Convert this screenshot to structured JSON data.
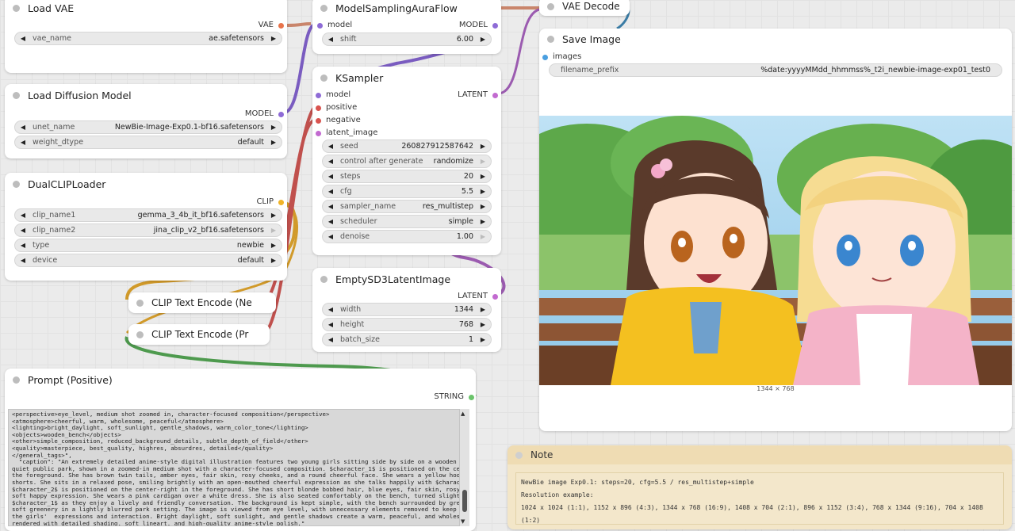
{
  "nodes": {
    "load_vae": {
      "title": "Load VAE",
      "output": "VAE",
      "widget_name": "vae_name",
      "widget_value": "ae.safetensors"
    },
    "model_sampling": {
      "title": "ModelSamplingAuraFlow",
      "input": "model",
      "output": "MODEL",
      "widget_name": "shift",
      "widget_value": "6.00"
    },
    "vae_decode": {
      "title": "VAE Decode"
    },
    "save_image": {
      "title": "Save Image",
      "input": "images",
      "widget_name": "filename_prefix",
      "widget_value": "%date:yyyyMMdd_hhmmss%_t2i_newbie-image-exp01_test0",
      "size_label": "1344 × 768"
    },
    "load_diffusion": {
      "title": "Load Diffusion Model",
      "output": "MODEL",
      "widgets": [
        {
          "name": "unet_name",
          "value": "NewBie-Image-Exp0.1-bf16.safetensors"
        },
        {
          "name": "weight_dtype",
          "value": "default"
        }
      ]
    },
    "ksampler": {
      "title": "KSampler",
      "output": "LATENT",
      "inputs": [
        "model",
        "positive",
        "negative",
        "latent_image"
      ],
      "widgets": [
        {
          "name": "seed",
          "value": "260827912587642"
        },
        {
          "name": "control after generate",
          "value": "randomize"
        },
        {
          "name": "steps",
          "value": "20"
        },
        {
          "name": "cfg",
          "value": "5.5"
        },
        {
          "name": "sampler_name",
          "value": "res_multistep"
        },
        {
          "name": "scheduler",
          "value": "simple"
        },
        {
          "name": "denoise",
          "value": "1.00"
        }
      ]
    },
    "dual_clip": {
      "title": "DualCLIPLoader",
      "output": "CLIP",
      "widgets": [
        {
          "name": "clip_name1",
          "value": "gemma_3_4b_it_bf16.safetensors"
        },
        {
          "name": "clip_name2",
          "value": "jina_clip_v2_bf16.safetensors"
        },
        {
          "name": "type",
          "value": "newbie"
        },
        {
          "name": "device",
          "value": "default"
        }
      ]
    },
    "empty_latent": {
      "title": "EmptySD3LatentImage",
      "output": "LATENT",
      "widgets": [
        {
          "name": "width",
          "value": "1344"
        },
        {
          "name": "height",
          "value": "768"
        },
        {
          "name": "batch_size",
          "value": "1"
        }
      ]
    },
    "clip_text_neg": {
      "title": "CLIP Text Encode (Ne"
    },
    "clip_text_pos": {
      "title": "CLIP Text Encode (Pr"
    },
    "prompt_positive": {
      "title": "Prompt (Positive)",
      "output": "STRING",
      "text": "<perspective>eye_level, medium shot zoomed in, character-focused composition</perspective>\n<atmosphere>cheerful, warm, wholesome, peaceful</atmosphere>\n<lighting>bright_daylight, soft_sunlight, gentle_shadows, warm_color_tone</lighting>\n<objects>wooden_bench</objects>\n<other>simple_composition, reduced_background_details, subtle_depth_of_field</other>\n<quality>masterpiece, best_quality, highres, absurdres, detailed</quality>\n</general_tags>\",\n  \"caption\": \"An extremely detailed anime-style digital illustration features two young girls sitting side by side on a wooden bench in a\nquiet public park, shown in a zoomed-in medium shot with a character-focused composition. $character_1$ is positioned on the center-left in\nthe foreground. She has brown twin tails, amber eyes, fair skin, rosy cheeks, and a round cheerful face. She wears a yellow hoodie and denim\nshorts. She sits in a relaxed pose, smiling brightly with an open-mouthed cheerful expression as she talks happily with $character_2$.\n$character_2$ is positioned on the center-right in the foreground. She has short blonde bobbed hair, blue eyes, fair skin, rosy cheeks, and a\nsoft happy expression. She wears a pink cardigan over a white dress. She is also seated comfortably on the bench, turned slightly toward\n$character_1$ as they enjoy a lively and friendly conversation. The background is kept simple, with the bench surrounded by green trees and\nsoft greenery in a lightly blurred park setting. The image is viewed from eye level, with unnecessary elements removed to keep attention on\nthe girls'  expressions and interaction. Bright daylight, soft sunlight, and gentle shadows create a warm, peaceful, and wholesome atmosphere,\nrendered with detailed shading, soft lineart, and high-quality anime-style polish.\"\n  }\n}"
    },
    "note": {
      "title": "Note",
      "lines": [
        "NewBie image Exp0.1: steps=20, cfg=5.5 / res_multistep+simple",
        "Resolution example:",
        "1024 x 1024 (1:1), 1152 x 896 (4:3), 1344 x 768 (16:9), 1408 x 704 (2:1), 896 x 1152 (3:4), 768 x 1344 (9:16), 704 x 1408 (1:2)"
      ]
    }
  },
  "colors": {
    "model": "#8e6bd6",
    "vae": "#e8734a",
    "clip": "#f0b429",
    "conditioning_pos": "#5a9e5a",
    "conditioning_neg": "#d9534f",
    "latent": "#c26ad0",
    "image": "#4a9fe0",
    "string": "#6bc46b"
  }
}
